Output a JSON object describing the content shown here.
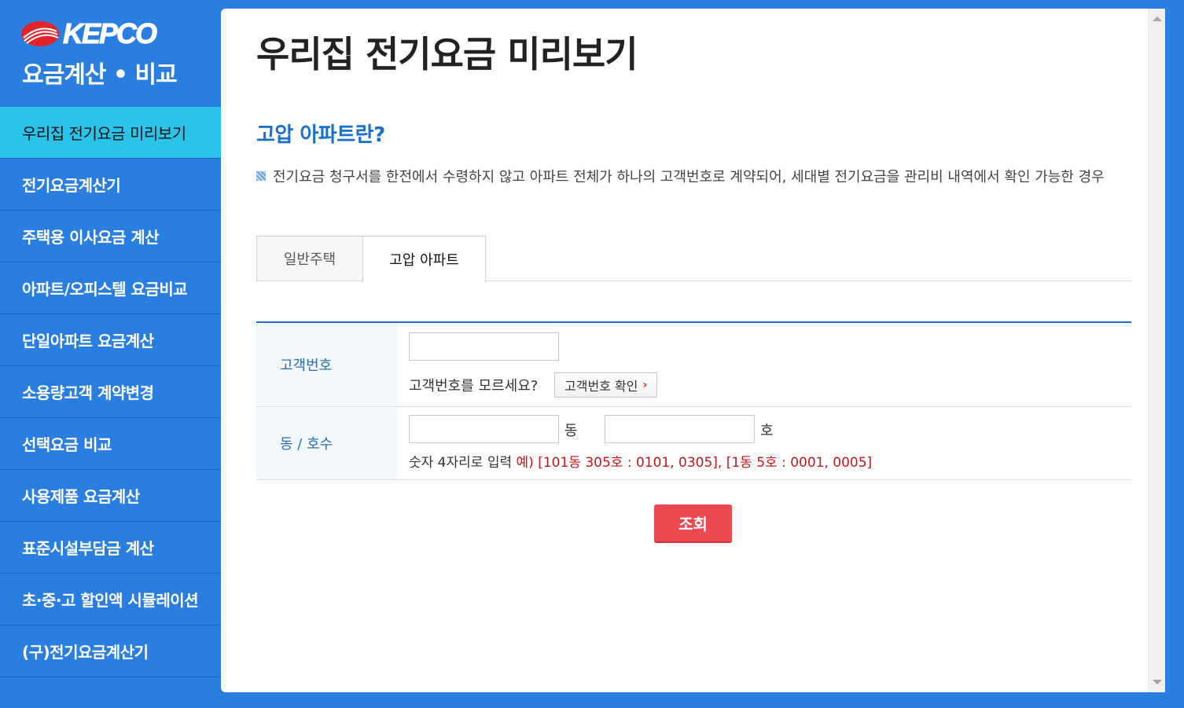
{
  "brand": {
    "logo_text": "KEPCO",
    "subtitle": "요금계산 • 비교"
  },
  "sidebar": {
    "items": [
      {
        "label": "우리집 전기요금 미리보기",
        "active": true
      },
      {
        "label": "전기요금계산기"
      },
      {
        "label": "주택용 이사요금 계산"
      },
      {
        "label": "아파트/오피스텔 요금비교"
      },
      {
        "label": "단일아파트 요금계산"
      },
      {
        "label": "소용량고객 계약변경"
      },
      {
        "label": "선택요금 비교"
      },
      {
        "label": "사용제품 요금계산"
      },
      {
        "label": "표준시설부담금 계산"
      },
      {
        "label": "초·중·고 할인액 시뮬레이션"
      },
      {
        "label": "(구)전기요금계산기"
      }
    ]
  },
  "main": {
    "title": "우리집 전기요금 미리보기",
    "section_title": "고압 아파트란?",
    "description": "전기요금 청구서를 한전에서 수령하지 않고 아파트 전체가 하나의 고객번호로 계약되어, 세대별 전기요금을 관리비 내역에서 확인 가능한 경우",
    "tabs": [
      {
        "label": "일반주택",
        "active": false
      },
      {
        "label": "고압 아파트",
        "active": true
      }
    ],
    "form": {
      "customer_label": "고객번호",
      "customer_value": "",
      "customer_help": "고객번호를 모르세요?",
      "customer_check_button": "고객번호 확인",
      "unit_label": "동 / 호수",
      "dong_value": "",
      "dong_unit": "동",
      "ho_value": "",
      "ho_unit": "호",
      "note_prefix": "숫자 4자리로 입력 ",
      "note_example": "예) [101동 305호 : 0101, 0305], [1동 5호 : 0001, 0005]"
    },
    "search_button": "조회"
  },
  "colors": {
    "brand_blue": "#2a7ee0",
    "active_cyan": "#2ac3ea",
    "heading_blue": "#1a6fc6",
    "accent_red": "#ec4851"
  }
}
